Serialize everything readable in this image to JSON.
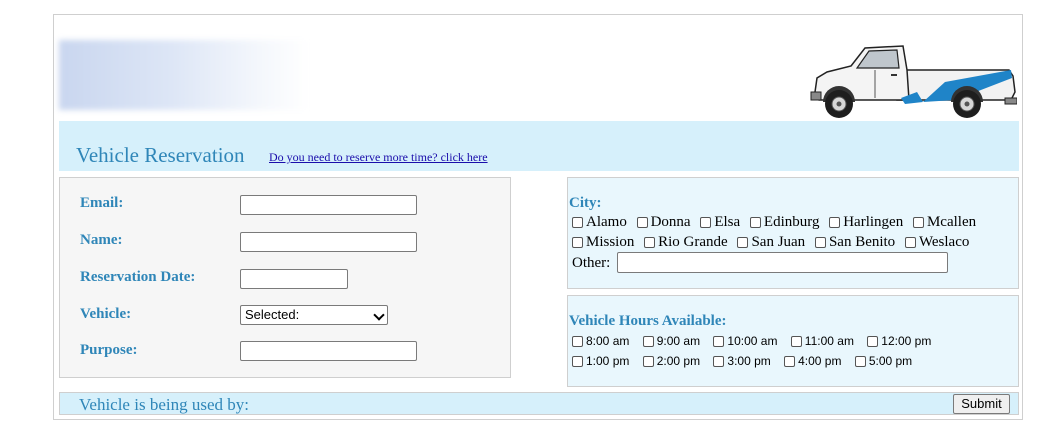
{
  "header": {
    "title": "Vehicle Reservation",
    "more_time_link": "Do you need to reserve more time? click here"
  },
  "form": {
    "email_label": "Email:",
    "name_label": "Name:",
    "date_label": "Reservation Date:",
    "vehicle_label": "Vehicle:",
    "vehicle_selected": "Selected:",
    "purpose_label": "Purpose:"
  },
  "city": {
    "label": "City:",
    "row1": [
      "Alamo",
      "Donna",
      "Elsa",
      "Edinburg",
      "Harlingen",
      "Mcallen"
    ],
    "row2": [
      "Mission",
      "Rio Grande",
      "San Juan",
      "San Benito",
      "Weslaco"
    ],
    "other_label": "Other:"
  },
  "hours": {
    "label": "Vehicle Hours Available:",
    "row1": [
      "8:00 am",
      "9:00 am",
      "10:00 am",
      "11:00 am",
      "12:00 pm"
    ],
    "row2": [
      "1:00 pm",
      "2:00 pm",
      "3:00 pm",
      "4:00 pm",
      "5:00 pm"
    ]
  },
  "footer": {
    "used_by": "Vehicle is being used by:",
    "submit_label": "Submit"
  },
  "colors": {
    "accent": "#2f86b8",
    "light_blue_bg": "#d6f0fb",
    "panel_blue": "#e9f7fd"
  },
  "icons": {
    "banner": "pickup-truck-icon",
    "logo": "logo-blurred"
  }
}
